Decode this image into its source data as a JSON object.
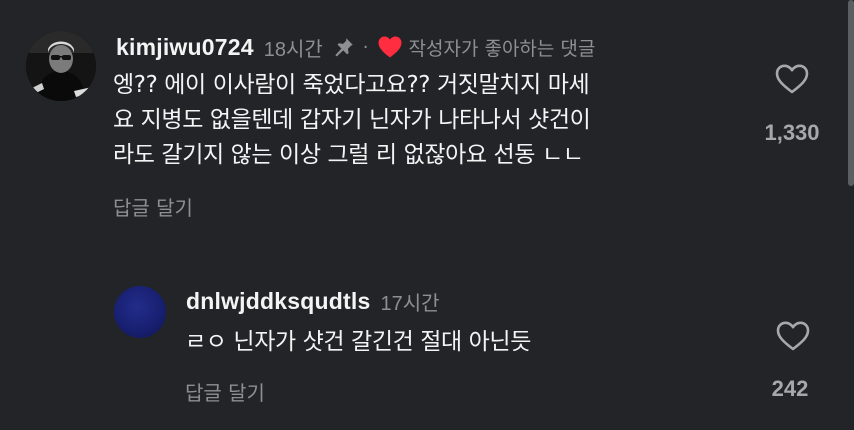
{
  "main_comment": {
    "username": "kimjiwu0724",
    "time": "18시간",
    "separator": "·",
    "creator_liked": "작성자가 좋아하는 댓글",
    "text_lines": [
      "엥?? 에이 이사람이 죽었다고요?? 거짓말치지 마세",
      "요 지병도 없을텐데 갑자기 닌자가 나타나서 샷건이",
      "라도 갈기지 않는 이상 그럴 리 없잖아요 선동 ㄴㄴ"
    ],
    "reply_label": "답글 달기",
    "like_count": "1,330",
    "icons": {
      "avatar": "profile-avatar",
      "pinned": "pin-icon",
      "creator_heart": "heart-filled-icon",
      "like": "heart-outline-icon"
    }
  },
  "reply_comment": {
    "username": "dnlwjddksqudtls",
    "time": "17시간",
    "text": "ㄹㅇ 닌자가 샷건 갈긴건 절대 아닌듯",
    "reply_label": "답글 달기",
    "like_count": "242",
    "icons": {
      "avatar": "profile-avatar",
      "like": "heart-outline-icon"
    }
  },
  "colors": {
    "background": "#232427",
    "primary_text": "#f4f4f4",
    "secondary_text": "#8e8f93",
    "creator_heart": "#ff2d3f",
    "reply_avatar": "#1b2278"
  }
}
